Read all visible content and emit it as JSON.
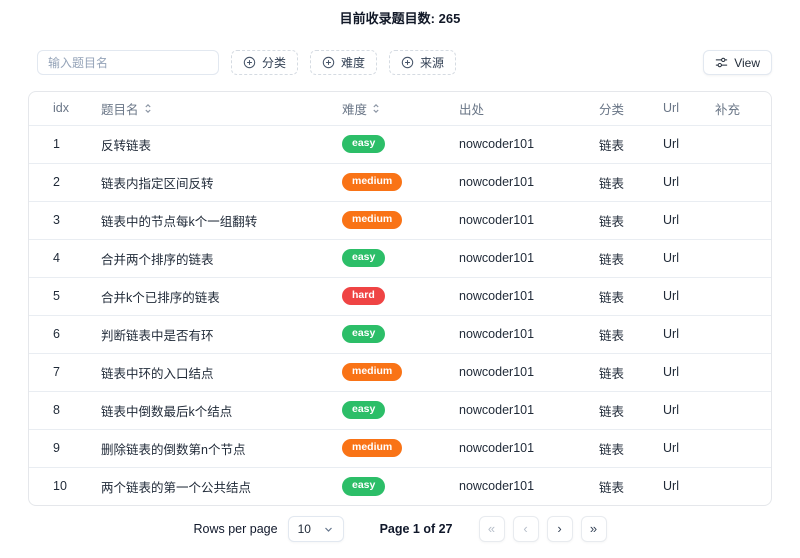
{
  "page": {
    "title": "目前收录题目数: 265"
  },
  "toolbar": {
    "search_placeholder": "输入题目名",
    "filters": [
      {
        "label": "分类"
      },
      {
        "label": "难度"
      },
      {
        "label": "来源"
      }
    ],
    "view_label": "View"
  },
  "table": {
    "columns": [
      {
        "key": "idx",
        "label": "idx",
        "sortable": false
      },
      {
        "key": "title",
        "label": "题目名",
        "sortable": true
      },
      {
        "key": "difficulty",
        "label": "难度",
        "sortable": true
      },
      {
        "key": "source",
        "label": "出处",
        "sortable": false
      },
      {
        "key": "category",
        "label": "分类",
        "sortable": false
      },
      {
        "key": "url",
        "label": "Url",
        "sortable": false
      },
      {
        "key": "extra",
        "label": "补充",
        "sortable": false
      }
    ],
    "rows": [
      {
        "idx": "1",
        "title": "反转链表",
        "difficulty": "easy",
        "source": "nowcoder101",
        "category": "链表",
        "url": "Url",
        "extra": ""
      },
      {
        "idx": "2",
        "title": "链表内指定区间反转",
        "difficulty": "medium",
        "source": "nowcoder101",
        "category": "链表",
        "url": "Url",
        "extra": ""
      },
      {
        "idx": "3",
        "title": "链表中的节点每k个一组翻转",
        "difficulty": "medium",
        "source": "nowcoder101",
        "category": "链表",
        "url": "Url",
        "extra": ""
      },
      {
        "idx": "4",
        "title": "合并两个排序的链表",
        "difficulty": "easy",
        "source": "nowcoder101",
        "category": "链表",
        "url": "Url",
        "extra": ""
      },
      {
        "idx": "5",
        "title": "合并k个已排序的链表",
        "difficulty": "hard",
        "source": "nowcoder101",
        "category": "链表",
        "url": "Url",
        "extra": ""
      },
      {
        "idx": "6",
        "title": "判断链表中是否有环",
        "difficulty": "easy",
        "source": "nowcoder101",
        "category": "链表",
        "url": "Url",
        "extra": ""
      },
      {
        "idx": "7",
        "title": "链表中环的入口结点",
        "difficulty": "medium",
        "source": "nowcoder101",
        "category": "链表",
        "url": "Url",
        "extra": ""
      },
      {
        "idx": "8",
        "title": "链表中倒数最后k个结点",
        "difficulty": "easy",
        "source": "nowcoder101",
        "category": "链表",
        "url": "Url",
        "extra": ""
      },
      {
        "idx": "9",
        "title": "删除链表的倒数第n个节点",
        "difficulty": "medium",
        "source": "nowcoder101",
        "category": "链表",
        "url": "Url",
        "extra": ""
      },
      {
        "idx": "10",
        "title": "两个链表的第一个公共结点",
        "difficulty": "easy",
        "source": "nowcoder101",
        "category": "链表",
        "url": "Url",
        "extra": ""
      }
    ]
  },
  "difficulty_colors": {
    "easy": "#2CBE68",
    "medium": "#F97316",
    "hard": "#EF4444"
  },
  "pagination": {
    "rows_per_page_label": "Rows per page",
    "rows_per_page_value": "10",
    "page_info": "Page 1 of 27",
    "buttons": [
      {
        "name": "first-page-button",
        "glyph": "«",
        "disabled": true
      },
      {
        "name": "prev-page-button",
        "glyph": "‹",
        "disabled": true
      },
      {
        "name": "next-page-button",
        "glyph": "›",
        "disabled": false
      },
      {
        "name": "last-page-button",
        "glyph": "»",
        "disabled": false
      }
    ]
  }
}
